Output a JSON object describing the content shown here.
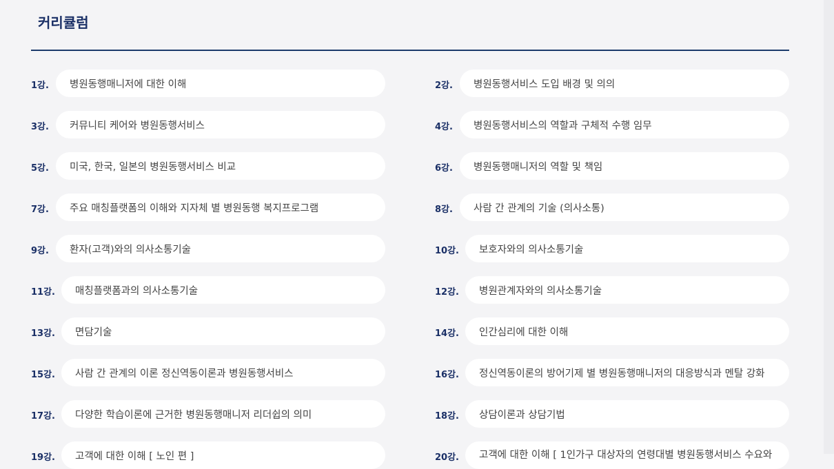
{
  "section": {
    "title": "커리큘럼"
  },
  "lessons": [
    {
      "num": "1강.",
      "title": "병원동행매니저에 대한 이해"
    },
    {
      "num": "2강.",
      "title": "병원동행서비스 도입 배경 및 의의"
    },
    {
      "num": "3강.",
      "title": "커뮤니티 케어와 병원동행서비스"
    },
    {
      "num": "4강.",
      "title": "병원동행서비스의 역할과 구체적 수행 임무"
    },
    {
      "num": "5강.",
      "title": "미국, 한국, 일본의 병원동행서비스 비교"
    },
    {
      "num": "6강.",
      "title": "병원동행매니저의 역할 및 책임"
    },
    {
      "num": "7강.",
      "title": "주요 매칭플랫폼의 이해와 지자체 별 병원동행 복지프로그램"
    },
    {
      "num": "8강.",
      "title": "사람 간 관계의 기술 (의사소통)"
    },
    {
      "num": "9강.",
      "title": "환자(고객)와의 의사소통기술"
    },
    {
      "num": "10강.",
      "title": "보호자와의 의사소통기술"
    },
    {
      "num": "11강.",
      "title": "매칭플랫폼과의 의사소통기술"
    },
    {
      "num": "12강.",
      "title": "병원관계자와의 의사소통기술"
    },
    {
      "num": "13강.",
      "title": "면담기술"
    },
    {
      "num": "14강.",
      "title": "인간심리에 대한 이해"
    },
    {
      "num": "15강.",
      "title": "사람 간 관계의 이론 정신역동이론과 병원동행서비스"
    },
    {
      "num": "16강.",
      "title": "정신역동이론의 방어기제 별 병원동행매니저의 대응방식과 멘탈 강화"
    },
    {
      "num": "17강.",
      "title": "다양한 학습이론에 근거한 병원동행매니저 리더쉽의 의미"
    },
    {
      "num": "18강.",
      "title": "상담이론과 상담기법"
    },
    {
      "num": "19강.",
      "title": "고객에 대한 이해 [ 노인 편 ]"
    },
    {
      "num": "20강.",
      "title": "고객에 대한 이해 [ 1인가구 대상자의 연령대별 병원동행서비스 수요와"
    }
  ]
}
